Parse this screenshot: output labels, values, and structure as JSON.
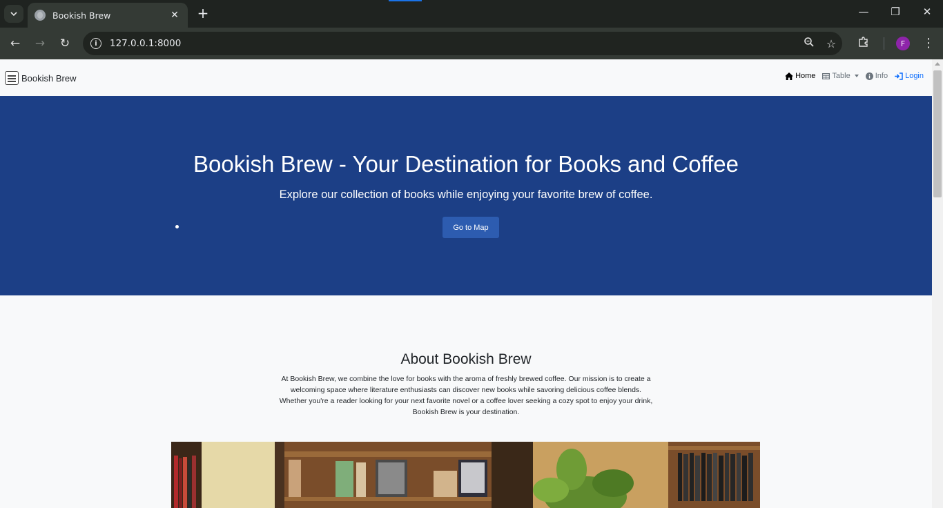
{
  "browser": {
    "tab_title": "Bookish Brew",
    "url": "127.0.0.1:8000",
    "profile_initial": "F"
  },
  "navbar": {
    "brand": "Bookish Brew",
    "links": {
      "home": "Home",
      "table": "Table",
      "info": "Info",
      "login": "Login"
    }
  },
  "hero": {
    "title": "Bookish Brew - Your Destination for Books and Coffee",
    "subtitle": "Explore our collection of books while enjoying your favorite brew of coffee.",
    "button": "Go to Map"
  },
  "about": {
    "title": "About Bookish Brew",
    "text": "At Bookish Brew, we combine the love for books with the aroma of freshly brewed coffee. Our mission is to create a welcoming space where literature enthusiasts can discover new books while savoring delicious coffee blends. Whether you're a reader looking for your next favorite novel or a coffee lover seeking a cozy spot to enjoy your drink, Bookish Brew is your destination."
  },
  "colors": {
    "hero_bg": "#1c3f86",
    "button_bg": "#2d5cb0",
    "login_link": "#0d6efd"
  }
}
